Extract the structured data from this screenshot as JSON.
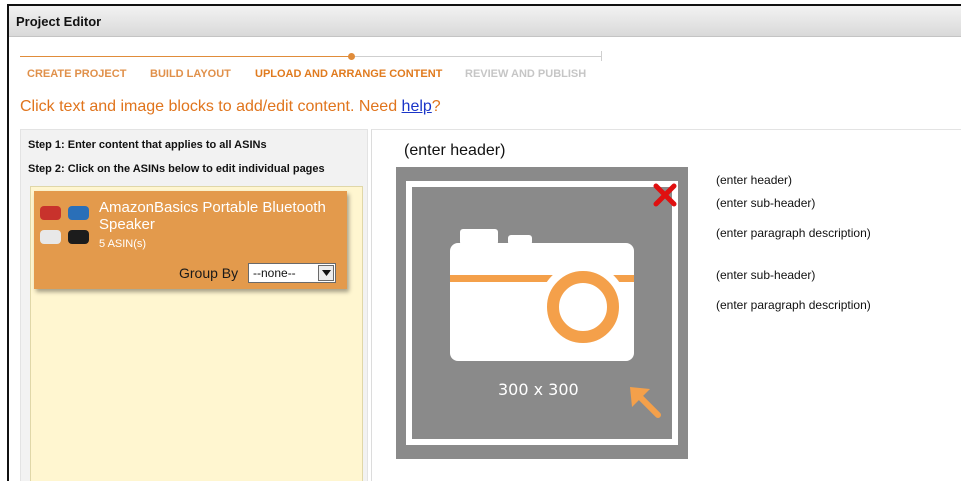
{
  "window": {
    "title": "Project Editor"
  },
  "steps": [
    {
      "label": "CREATE PROJECT",
      "state": "done"
    },
    {
      "label": "BUILD LAYOUT",
      "state": "done"
    },
    {
      "label": "UPLOAD AND ARRANGE CONTENT",
      "state": "active"
    },
    {
      "label": "REVIEW AND PUBLISH",
      "state": "todo"
    }
  ],
  "instruction": {
    "text_before": "Click text and image blocks to add/edit content. Need ",
    "link": "help",
    "text_after": "?"
  },
  "left_panel": {
    "step1": "Step 1: Enter content that applies to all ASINs",
    "step2": "Step 2: Click on the ASINs below to edit individual pages",
    "product_card": {
      "title": "AmazonBasics Portable Bluetooth Speaker",
      "asin_count": "5 ASIN(s)",
      "group_by_label": "Group By",
      "group_by_value": "--none--",
      "thumbnail_colors": [
        "#c8322c",
        "#2a6fb8",
        "#e8e8e8",
        "#1c1c1c"
      ]
    }
  },
  "content": {
    "header": "(enter header)",
    "image_placeholder": {
      "label": "300 x 300",
      "icons": [
        "camera-icon",
        "close-icon",
        "resize-arrow-icon"
      ]
    },
    "side_text": {
      "header": "(enter header)",
      "sub_header_1": "(enter sub-header)",
      "paragraph_1": "(enter paragraph description)",
      "sub_header_2": "(enter sub-header)",
      "paragraph_2": "(enter paragraph description)"
    }
  },
  "colors": {
    "accent_orange": "#e07b1f",
    "card_orange": "#e39a4c",
    "list_background": "#fff6d0",
    "placeholder_gray": "#8a8a8a",
    "link_blue": "#1a35c8",
    "close_red": "#e01010"
  }
}
